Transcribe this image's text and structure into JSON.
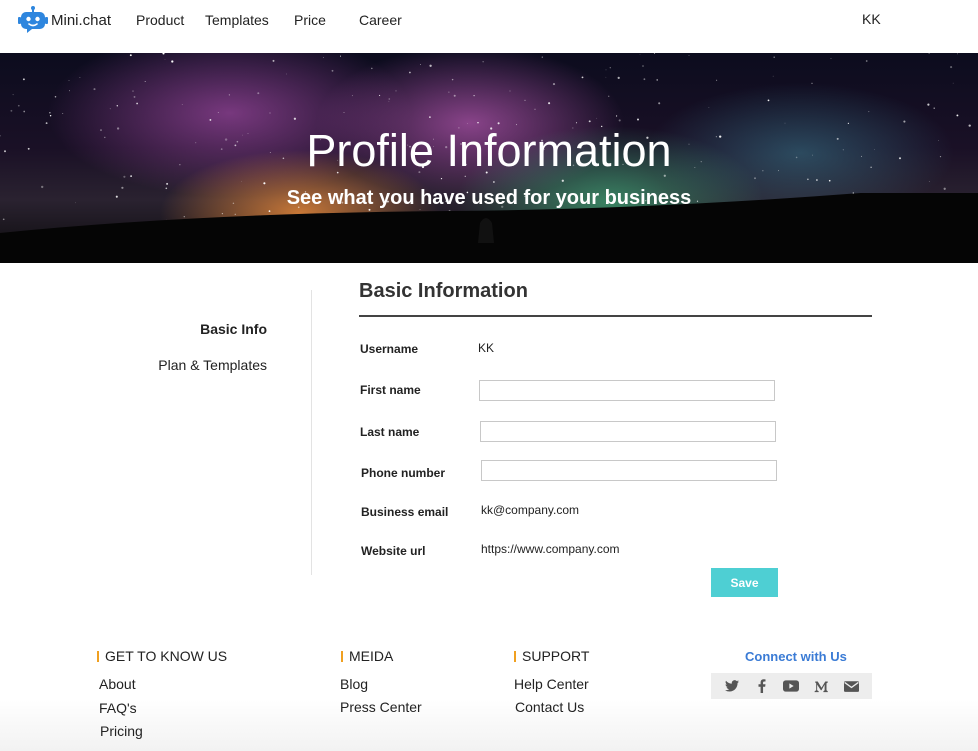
{
  "brand": {
    "name": "Mini.chat",
    "icon": "robot-logo-icon",
    "accent": "#2e86de"
  },
  "nav": {
    "items": [
      {
        "label": "Product"
      },
      {
        "label": "Templates"
      },
      {
        "label": "Price"
      },
      {
        "label": "Career"
      }
    ],
    "user": "KK"
  },
  "hero": {
    "title": "Profile Information",
    "subtitle": "See what you have used for your business"
  },
  "sidebar": {
    "items": [
      {
        "label": "Basic Info",
        "active": true
      },
      {
        "label": "Plan & Templates",
        "active": false
      }
    ]
  },
  "form": {
    "title": "Basic Information",
    "username": {
      "label": "Username",
      "value": "KK"
    },
    "first_name": {
      "label": "First name",
      "value": ""
    },
    "last_name": {
      "label": "Last name",
      "value": ""
    },
    "phone": {
      "label": "Phone number",
      "value": ""
    },
    "business_email": {
      "label": "Business email",
      "value": "kk@company.com"
    },
    "website": {
      "label": "Website url",
      "value": "https://www.company.com"
    },
    "save_label": "Save",
    "save_color": "#4ecfd3"
  },
  "footer": {
    "columns": [
      {
        "heading": "GET TO KNOW US",
        "links": [
          "About",
          "FAQ's",
          "Pricing"
        ]
      },
      {
        "heading": "MEIDA",
        "links": [
          "Blog",
          "Press Center"
        ]
      },
      {
        "heading": "SUPPORT",
        "links": [
          "Help Center",
          "Contact Us"
        ]
      }
    ],
    "connect_title": "Connect with Us",
    "connect_color": "#3a7bd5",
    "heading_bar_color": "#f0a020",
    "social": [
      "twitter-icon",
      "facebook-icon",
      "youtube-icon",
      "medium-icon",
      "email-icon"
    ]
  }
}
